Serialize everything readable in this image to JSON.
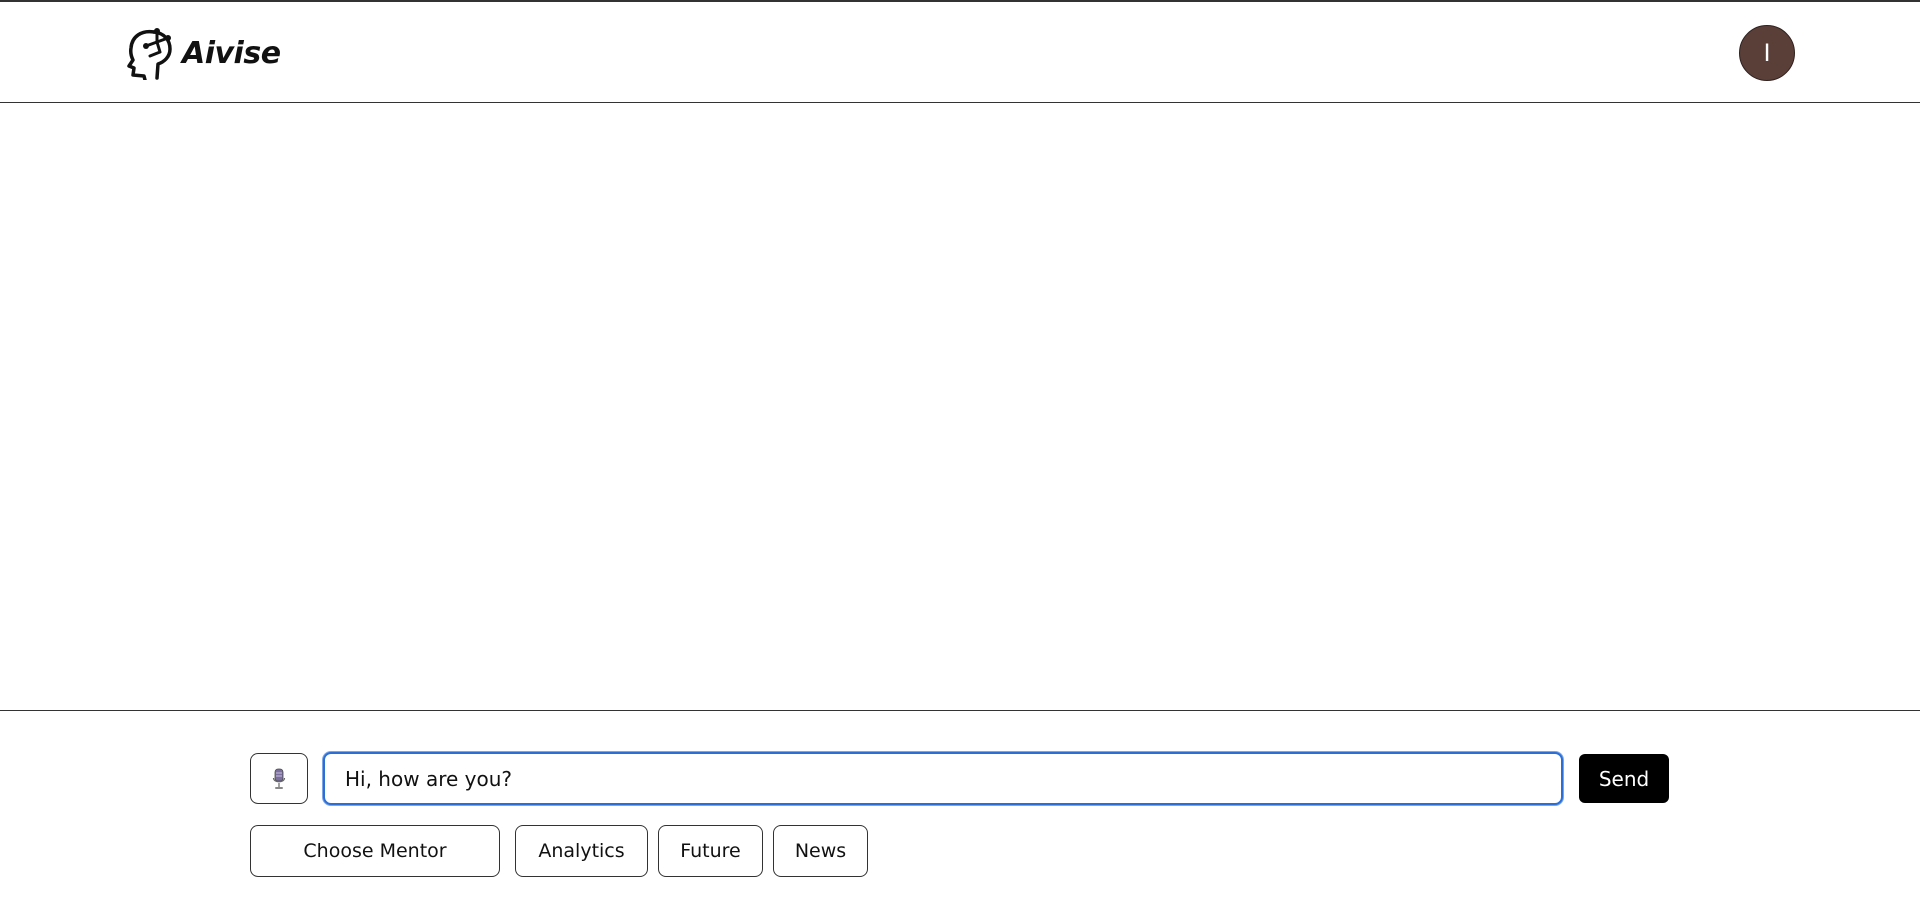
{
  "brand": {
    "name": "Aivise",
    "logo_icon": "robot-head-circuit-icon"
  },
  "user": {
    "avatar_initial": "I",
    "avatar_color": "#5a3e38"
  },
  "composer": {
    "mic_icon": "microphone-icon",
    "message_value": "Hi, how are you?",
    "send_label": "Send",
    "input_focus_color": "#2b6fd6"
  },
  "quick_actions": {
    "choose_mentor": "Choose Mentor",
    "analytics": "Analytics",
    "future": "Future",
    "news": "News"
  }
}
